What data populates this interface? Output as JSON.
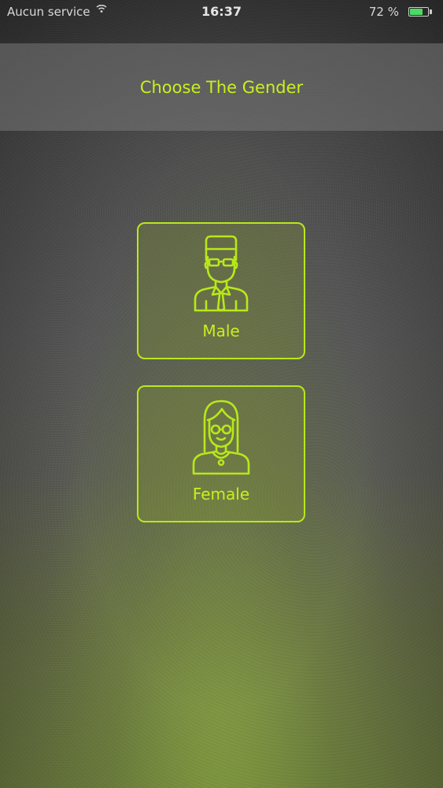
{
  "status_bar": {
    "carrier": "Aucun service",
    "wifi_icon": "wifi-icon",
    "time": "16:37",
    "battery_percent": "72 %",
    "battery_level": 0.72,
    "battery_color": "#4cd964"
  },
  "header": {
    "title": "Choose The Gender"
  },
  "options": [
    {
      "label": "Male",
      "icon": "male-avatar-icon"
    },
    {
      "label": "Female",
      "icon": "female-avatar-icon"
    }
  ],
  "colors": {
    "accent": "#c8f01e",
    "card_border": "#b8e81a"
  }
}
